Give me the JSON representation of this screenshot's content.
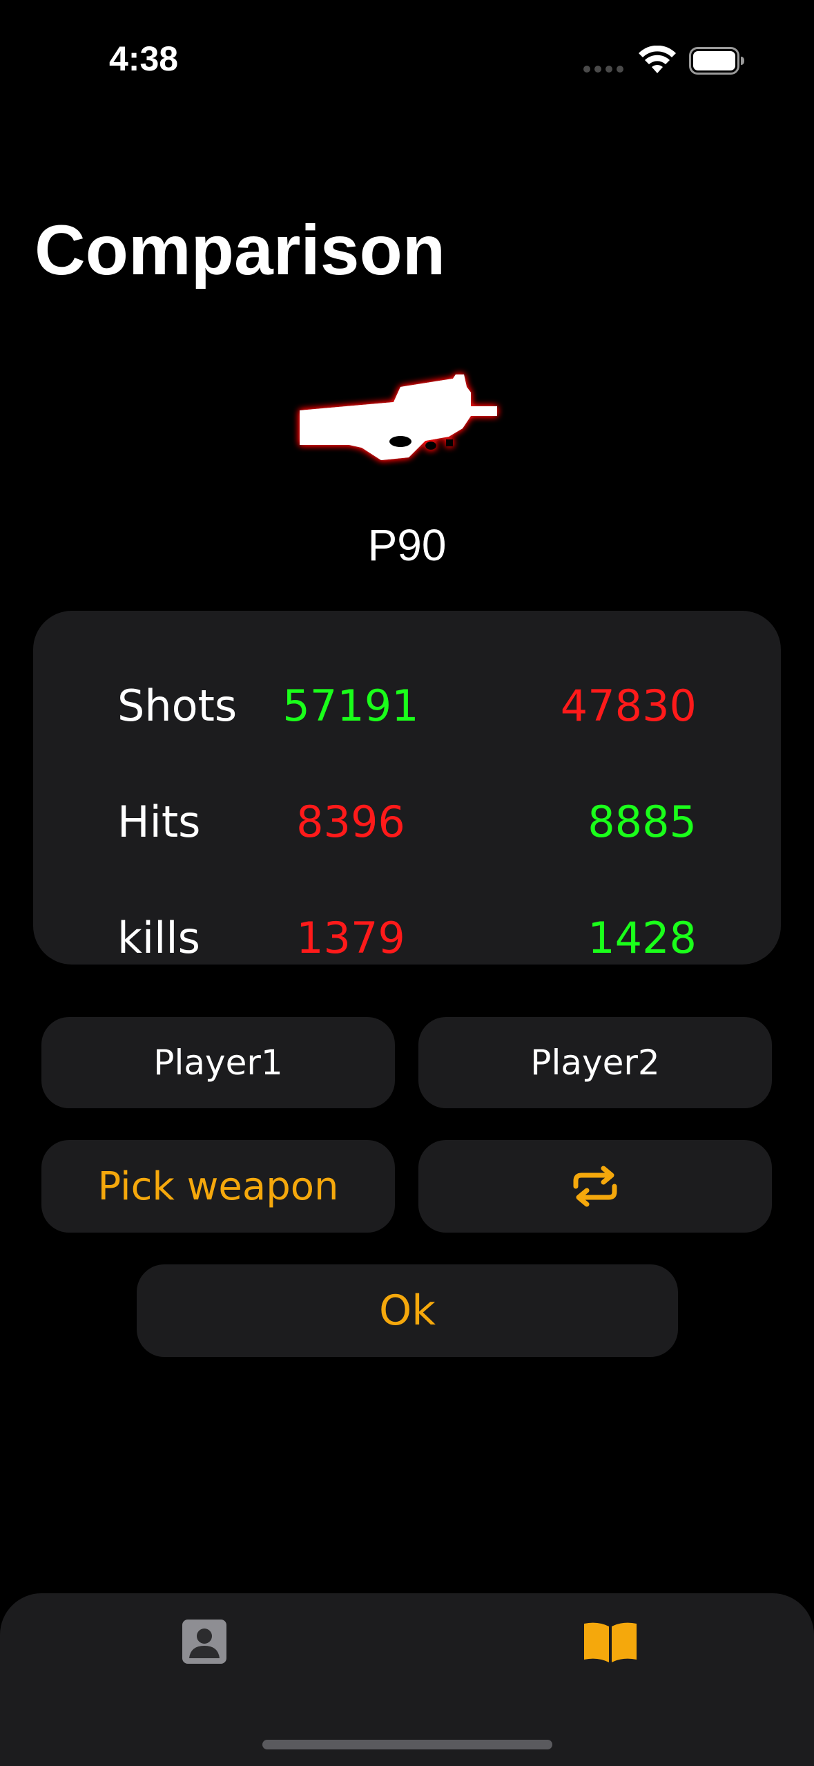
{
  "status_bar": {
    "time": "4:38"
  },
  "header": {
    "title": "Comparison"
  },
  "weapon": {
    "name": "P90",
    "icon": "p90-weapon-icon"
  },
  "stats": {
    "rows": [
      {
        "label": "Shots",
        "player1": "57191",
        "player2": "47830",
        "player1_color": "#1aff1a",
        "player2_color": "#ff1a1a"
      },
      {
        "label": "Hits",
        "player1": "8396",
        "player2": "8885",
        "player1_color": "#ff1a1a",
        "player2_color": "#1aff1a"
      },
      {
        "label": "kills",
        "player1": "1379",
        "player2": "1428",
        "player1_color": "#ff1a1a",
        "player2_color": "#1aff1a"
      }
    ]
  },
  "buttons": {
    "player1": "Player1",
    "player2": "Player2",
    "pick_weapon": "Pick weapon",
    "swap_icon": "swap-arrows-icon",
    "ok": "Ok"
  },
  "tab_bar": {
    "items": [
      {
        "icon": "person-crop-square-icon",
        "selected": false
      },
      {
        "icon": "book-open-icon",
        "selected": true
      }
    ]
  },
  "colors": {
    "accent": "#f5a80c",
    "background": "#000000",
    "card": "#1c1c1e",
    "better": "#1aff1a",
    "worse": "#ff1a1a"
  }
}
